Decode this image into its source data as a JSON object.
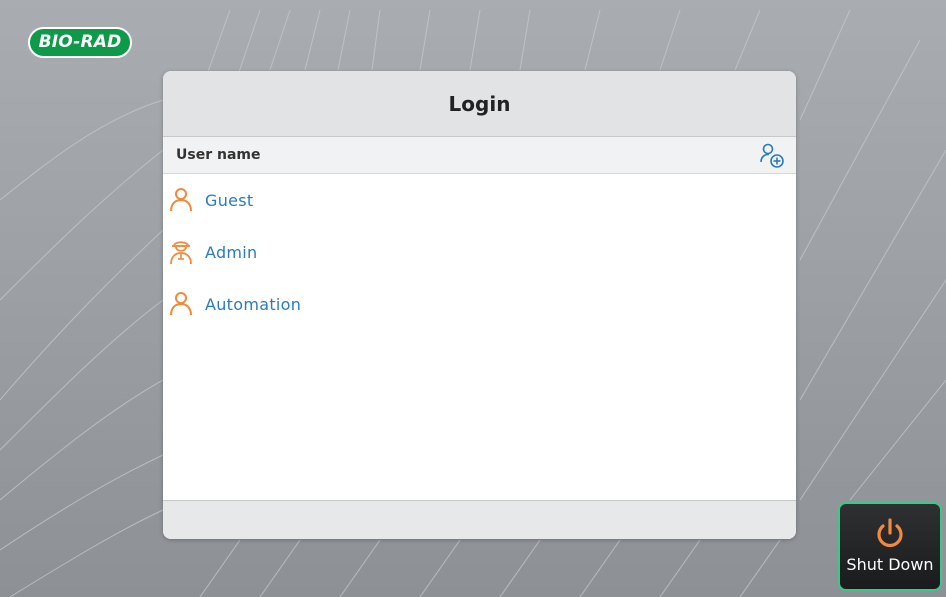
{
  "logo": {
    "text": "BIO-RAD"
  },
  "login": {
    "title": "Login",
    "column_header": "User name",
    "users": [
      {
        "name": "Guest",
        "icon": "user-icon"
      },
      {
        "name": "Admin",
        "icon": "admin-user-icon"
      },
      {
        "name": "Automation",
        "icon": "user-icon"
      }
    ]
  },
  "shutdown": {
    "label": "Shut Down",
    "icon": "power-icon"
  },
  "colors": {
    "brand_green": "#0f9a4a",
    "user_icon_orange": "#f08a3c",
    "user_name_blue": "#2b7bbd",
    "shutdown_border": "#3cc88a"
  }
}
